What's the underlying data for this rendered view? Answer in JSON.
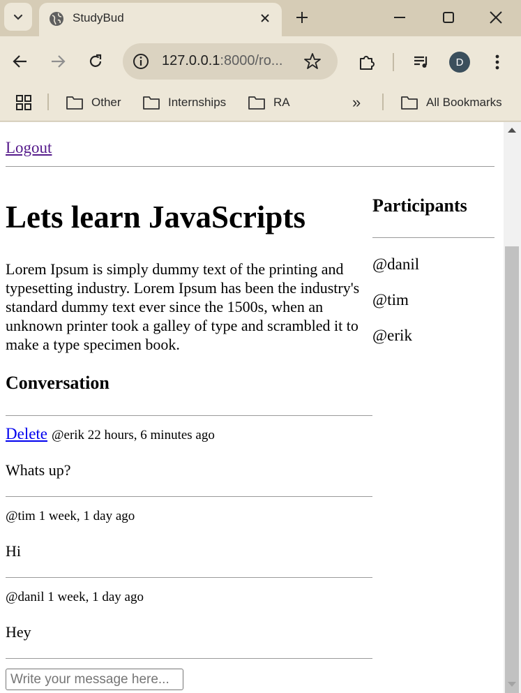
{
  "browser": {
    "tab": {
      "title": "StudyBud"
    },
    "url": {
      "host": "127.0.0.1",
      "rest": ":8000/ro..."
    },
    "avatar_initial": "D",
    "bookmarks": [
      {
        "label": "Other"
      },
      {
        "label": "Internships"
      },
      {
        "label": "RA"
      }
    ],
    "all_bookmarks_label": "All Bookmarks",
    "overflow_label": "»"
  },
  "page": {
    "logout_label": "Logout",
    "room": {
      "title": "Lets learn JavaScripts",
      "description": "Lorem Ipsum is simply dummy text of the printing and typesetting industry. Lorem Ipsum has been the industry's standard dummy text ever since the 1500s, when an unknown printer took a galley of type and scrambled it to make a type specimen book."
    },
    "conversation": {
      "heading": "Conversation",
      "delete_label": "Delete",
      "messages": [
        {
          "meta": "@erik 22 hours, 6 minutes ago",
          "body": "Whats up?"
        },
        {
          "meta": "@tim 1 week, 1 day ago",
          "body": "Hi"
        },
        {
          "meta": "@danil 1 week, 1 day ago",
          "body": "Hey"
        }
      ],
      "input_placeholder": "Write your message here..."
    },
    "participants": {
      "heading": "Participants",
      "list": [
        "@danil",
        "@tim",
        "@erik"
      ]
    }
  },
  "colors": {
    "tabstrip": "#d6ccb6",
    "toolbar": "#ede7d8",
    "visited_link": "#551a8b",
    "link": "#0000ee"
  }
}
